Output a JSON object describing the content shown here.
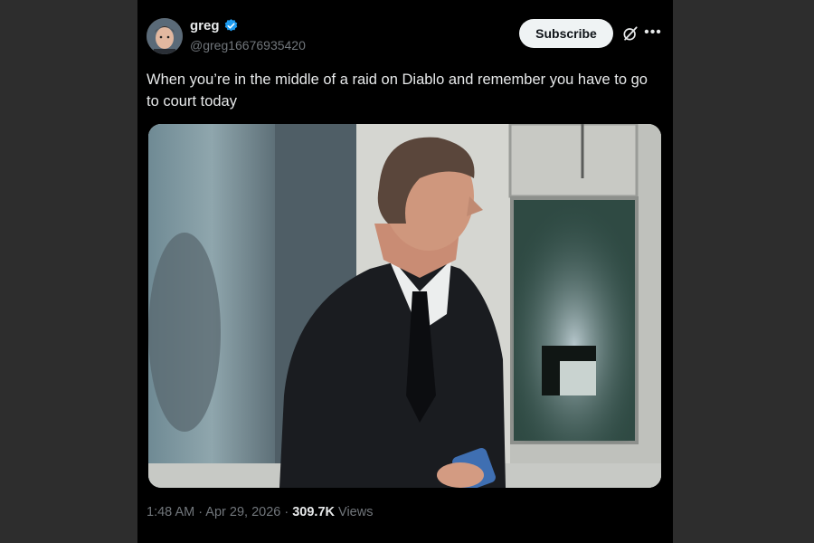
{
  "author": {
    "name": "greg",
    "handle": "@greg16676935420",
    "verified": true
  },
  "actions": {
    "subscribe_label": "Subscribe",
    "grok_icon": "grok-icon",
    "more_icon": "more-icon"
  },
  "tweet": {
    "text": "When you’re in the middle of a raid on Diablo and remember you have to go to court today",
    "time": "1:48 AM",
    "date": "Apr 29, 2026",
    "views_count": "309.7K",
    "views_label": "Views"
  },
  "colors": {
    "background": "#000000",
    "verified_badge": "#1d9bf0",
    "muted_text": "#71767b",
    "subscribe_bg": "#eff3f4"
  }
}
